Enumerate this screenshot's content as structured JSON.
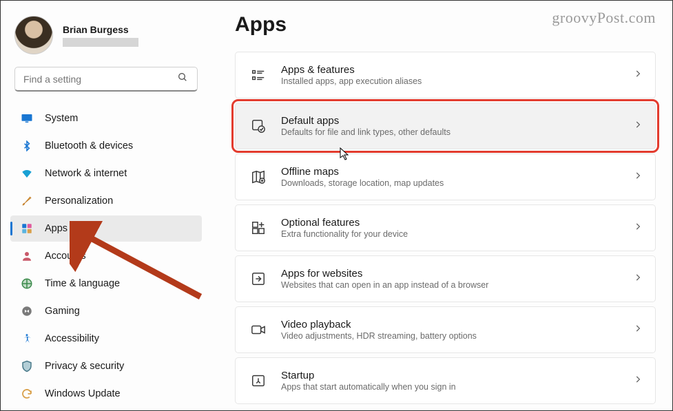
{
  "watermark": "groovyPost.com",
  "profile": {
    "name": "Brian Burgess"
  },
  "search": {
    "placeholder": "Find a setting"
  },
  "nav": [
    {
      "key": "system",
      "label": "System",
      "selected": false
    },
    {
      "key": "bluetooth",
      "label": "Bluetooth & devices",
      "selected": false
    },
    {
      "key": "network",
      "label": "Network & internet",
      "selected": false
    },
    {
      "key": "personalization",
      "label": "Personalization",
      "selected": false
    },
    {
      "key": "apps",
      "label": "Apps",
      "selected": true
    },
    {
      "key": "accounts",
      "label": "Accounts",
      "selected": false
    },
    {
      "key": "time",
      "label": "Time & language",
      "selected": false
    },
    {
      "key": "gaming",
      "label": "Gaming",
      "selected": false
    },
    {
      "key": "accessibility",
      "label": "Accessibility",
      "selected": false
    },
    {
      "key": "privacy",
      "label": "Privacy & security",
      "selected": false
    },
    {
      "key": "update",
      "label": "Windows Update",
      "selected": false
    }
  ],
  "page": {
    "title": "Apps"
  },
  "cards": [
    {
      "key": "apps-features",
      "title": "Apps & features",
      "sub": "Installed apps, app execution aliases",
      "highlight": false
    },
    {
      "key": "default-apps",
      "title": "Default apps",
      "sub": "Defaults for file and link types, other defaults",
      "highlight": true
    },
    {
      "key": "offline-maps",
      "title": "Offline maps",
      "sub": "Downloads, storage location, map updates",
      "highlight": false
    },
    {
      "key": "optional-features",
      "title": "Optional features",
      "sub": "Extra functionality for your device",
      "highlight": false
    },
    {
      "key": "apps-websites",
      "title": "Apps for websites",
      "sub": "Websites that can open in an app instead of a browser",
      "highlight": false
    },
    {
      "key": "video-playback",
      "title": "Video playback",
      "sub": "Video adjustments, HDR streaming, battery options",
      "highlight": false
    },
    {
      "key": "startup",
      "title": "Startup",
      "sub": "Apps that start automatically when you sign in",
      "highlight": false
    }
  ]
}
